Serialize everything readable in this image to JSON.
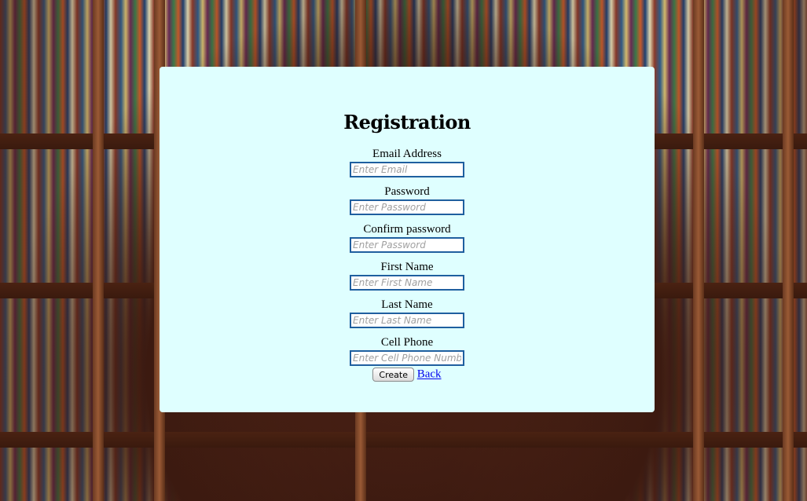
{
  "page": {
    "title": "Registration"
  },
  "form": {
    "fields": [
      {
        "label": "Email Address",
        "placeholder": "Enter Email",
        "value": ""
      },
      {
        "label": "Password",
        "placeholder": "Enter Password",
        "value": ""
      },
      {
        "label": "Confirm password",
        "placeholder": "Enter Password",
        "value": ""
      },
      {
        "label": "First Name",
        "placeholder": "Enter First Name",
        "value": ""
      },
      {
        "label": "Last Name",
        "placeholder": "Enter Last Name",
        "value": ""
      },
      {
        "label": "Cell Phone",
        "placeholder": "Enter Cell Phone Number",
        "value": ""
      }
    ],
    "create_label": "Create",
    "back_label": "Back"
  },
  "colors": {
    "panel_background": "#dfffff",
    "input_border": "#1f5f9f",
    "link": "#0000ee"
  },
  "background": {
    "icon": "library-bookshelves-image"
  }
}
